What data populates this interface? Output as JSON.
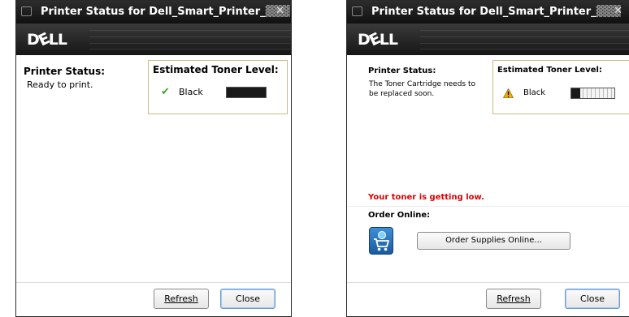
{
  "left_window": {
    "title": "Printer Status for Dell_Smart_Printer_",
    "title_suffix_obscured": "▓▓▓",
    "logo_text": "DƐLL",
    "status_heading": "Printer Status:",
    "status_message": "Ready to print.",
    "toner_heading": "Estimated Toner Level:",
    "toner_color_label": "Black",
    "toner_level_fraction": 1.0,
    "toner_status_icon": "checkmark-icon",
    "buttons": {
      "refresh": "Refresh",
      "close": "Close"
    }
  },
  "right_window": {
    "title": "Printer Status for Dell_Smart_Printer_",
    "title_suffix_obscured": "▓▓▓",
    "logo_text": "DƐLL",
    "status_heading": "Printer Status:",
    "status_message_line1": "The Toner Cartridge needs to",
    "status_message_line2": "be replaced soon.",
    "toner_heading": "Estimated Toner Level:",
    "toner_color_label": "Black",
    "toner_level_fraction": 0.2,
    "toner_status_icon": "warning-icon",
    "alert_text": "Your toner is getting low.",
    "order_heading": "Order Online:",
    "order_button": "Order Supplies Online...",
    "buttons": {
      "refresh": "Refresh",
      "close": "Close"
    }
  },
  "colors": {
    "titlebar": "#1c1c1c",
    "alert": "#e00000",
    "ok_check": "#3aa62a",
    "warning": "#f2b400",
    "toner_fill": "#1a1a1a",
    "toner_box_border": "#cdb98a"
  }
}
